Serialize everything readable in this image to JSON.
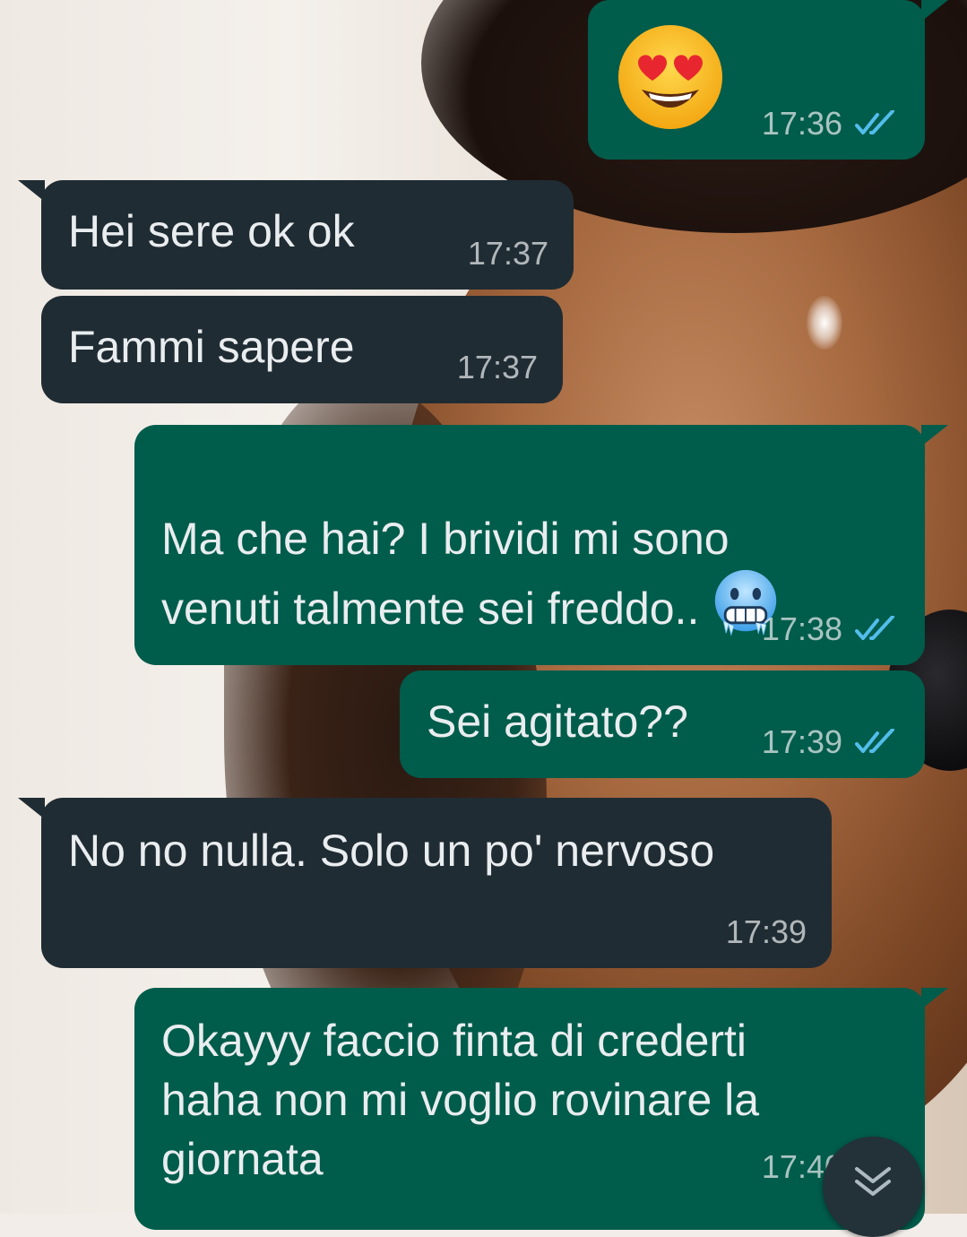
{
  "app": "WhatsApp",
  "colors": {
    "outgoing_bubble": "#005c4b",
    "incoming_bubble": "#202c33",
    "read_ticks": "#53bdeb",
    "text": "#e9edef"
  },
  "messages": [
    {
      "direction": "outgoing",
      "emoji": "smiling-face-with-heart-eyes",
      "text": "",
      "time": "17:36",
      "status": "read"
    },
    {
      "direction": "incoming",
      "text": "Hei sere ok ok",
      "time": "17:37"
    },
    {
      "direction": "incoming",
      "text": "Fammi sapere",
      "time": "17:37"
    },
    {
      "direction": "outgoing",
      "text": "Ma che hai? I brividi mi sono\nvenuti talmente sei freddo..",
      "trailing_emoji": "cold-face",
      "time": "17:38",
      "status": "read"
    },
    {
      "direction": "outgoing",
      "text": "Sei agitato??",
      "time": "17:39",
      "status": "read"
    },
    {
      "direction": "incoming",
      "text": "No no nulla. Solo un po' nervoso",
      "time": "17:39"
    },
    {
      "direction": "outgoing",
      "text": "Okayyy faccio finta di crederti\nhaha non mi voglio rovinare la\ngiornata",
      "time": "17:40",
      "status": "read"
    }
  ],
  "scroll_to_bottom": {
    "icon": "chevron-double-down-icon"
  }
}
